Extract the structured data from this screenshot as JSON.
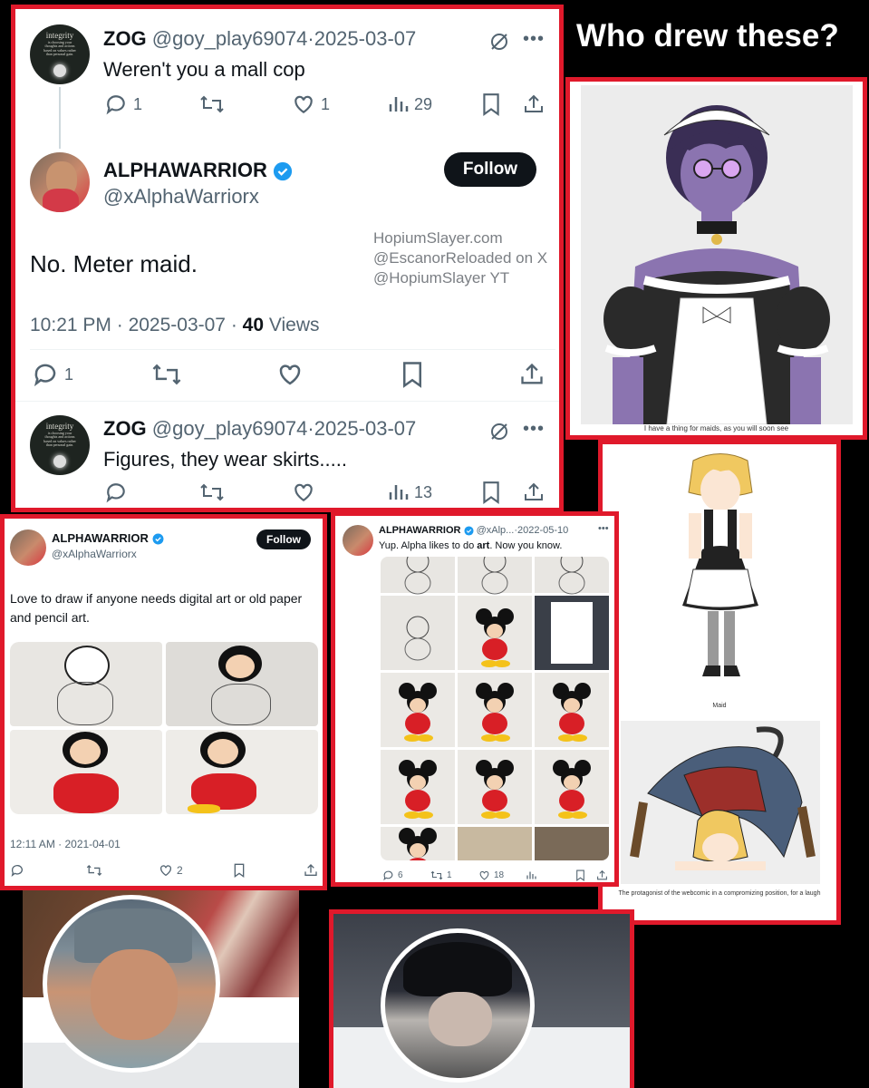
{
  "heading": "Who drew these?",
  "watermark": [
    "HopiumSlayer.com",
    "@EscanorReloaded on X",
    "@HopiumSlayer YT"
  ],
  "main_panel": {
    "reply1": {
      "avatar_text": [
        "integrity",
        "is choosing your",
        "thoughts and actions",
        "based on values rather",
        "than personal gain."
      ],
      "name": "ZOG",
      "handle": "@goy_play69074",
      "date": "2025-03-07",
      "dot": "·",
      "text": "Weren't you a mall cop",
      "replies": "1",
      "likes": "1",
      "views": "29"
    },
    "main_tweet": {
      "name": "ALPHAWARRIOR",
      "handle": "@xAlphaWarriorx",
      "follow": "Follow",
      "text": "No. Meter maid.",
      "time": "10:21 PM",
      "date": "2025-03-07",
      "views_count": "40",
      "views_label": "Views",
      "replies": "1"
    },
    "reply2": {
      "avatar_text": [
        "integrity",
        "is choosing your",
        "thoughts and actions",
        "based on values rather",
        "than personal gain."
      ],
      "name": "ZOG",
      "handle": "@goy_play69074",
      "date": "2025-03-07",
      "text": "Figures, they wear skirts.....",
      "views": "13"
    }
  },
  "art_panel_1": {
    "caption": "I have a thing for maids, as you will soon see"
  },
  "art_panel_2": {
    "caption_1": "Maid",
    "caption_2": "The protagonist of the webcomic in a compromizing position, for a laugh"
  },
  "tweet_left": {
    "name": "ALPHAWARRIOR",
    "handle": "@xAlphaWarriorx",
    "follow": "Follow",
    "text": "Love to draw if anyone needs digital art or old paper and pencil art.",
    "timestamp": "12:11 AM · 2021-04-01",
    "likes": "2"
  },
  "tweet_mid": {
    "name": "ALPHAWARRIOR",
    "handle": "@xAlp...",
    "date": "2022-05-10",
    "dot": "·",
    "text_pre": "Yup. Alpha likes to do ",
    "text_bold": "art",
    "text_post": ". Now you know.",
    "replies": "6",
    "retweets": "1",
    "likes": "18"
  },
  "colors": {
    "frame": "#e0192b",
    "verified": "#1d9bf0",
    "text": "#0f1419",
    "muted": "#536471",
    "mickey_red": "#d81f26",
    "mickey_yellow": "#f4c21a"
  }
}
